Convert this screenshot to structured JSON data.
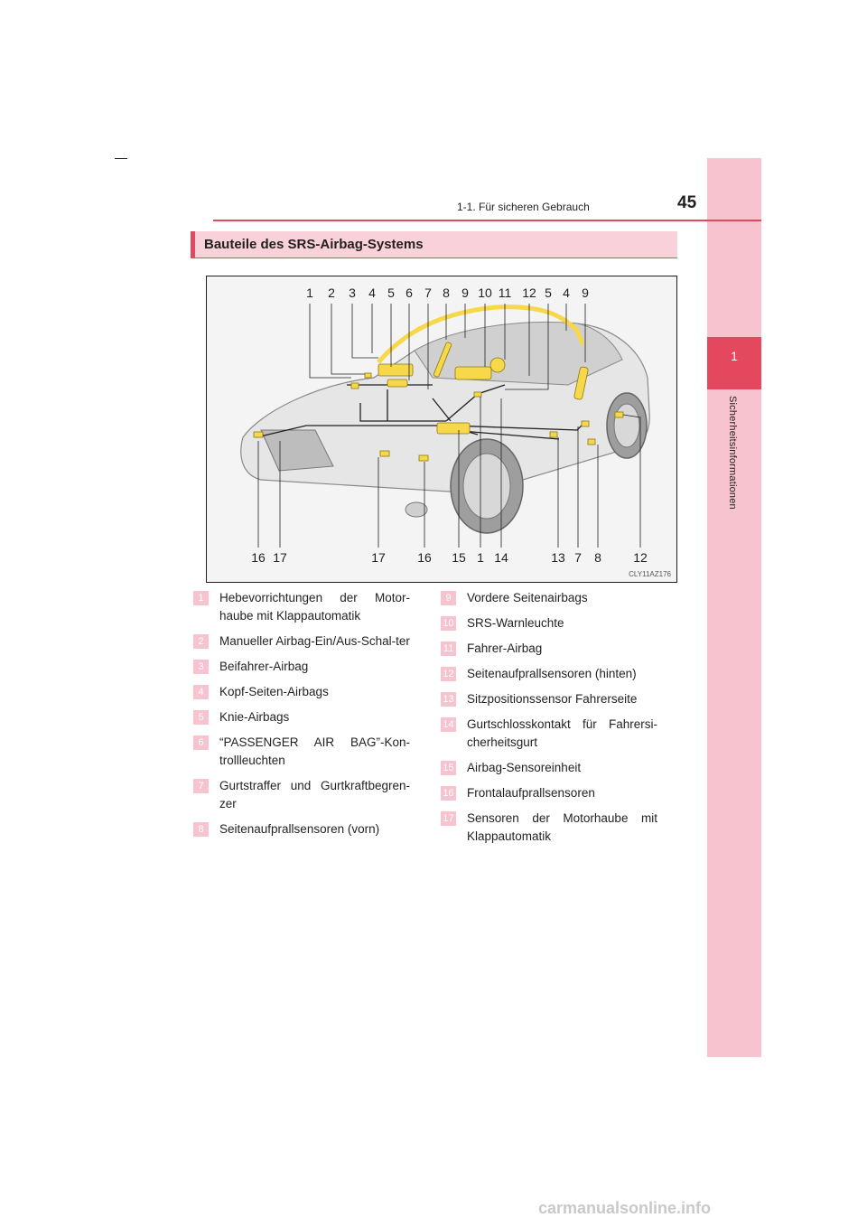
{
  "header": {
    "section": "1-1. Für sicheren Gebrauch",
    "page_number": "45"
  },
  "side_tab": {
    "chapter_number": "1",
    "chapter_title": "Sicherheitsinformationen"
  },
  "heading": "Bauteile des SRS-Airbag-Systems",
  "figure": {
    "top_callouts": [
      "1",
      "2",
      "3",
      "4",
      "5",
      "6",
      "7",
      "8",
      "9",
      "10",
      "11",
      "12",
      "5",
      "4",
      "9"
    ],
    "bottom_callouts": [
      "16",
      "17",
      "17",
      "16",
      "15",
      "1",
      "14",
      "13",
      "7",
      "8",
      "12"
    ],
    "code": "CLY11AZ176"
  },
  "items_left": [
    {
      "num": "1",
      "text": "Hebevorrichtungen der Motor-haube mit Klappautomatik"
    },
    {
      "num": "2",
      "text": "Manueller Airbag-Ein/Aus-Schal-ter"
    },
    {
      "num": "3",
      "text": "Beifahrer-Airbag"
    },
    {
      "num": "4",
      "text": "Kopf-Seiten-Airbags"
    },
    {
      "num": "5",
      "text": "Knie-Airbags"
    },
    {
      "num": "6",
      "text": "“PASSENGER AIR BAG”-Kon-trollleuchten"
    },
    {
      "num": "7",
      "text": "Gurtstraffer und Gurtkraftbegren-zer"
    },
    {
      "num": "8",
      "text": "Seitenaufprallsensoren (vorn)"
    }
  ],
  "items_right": [
    {
      "num": "9",
      "text": "Vordere Seitenairbags"
    },
    {
      "num": "10",
      "text": "SRS-Warnleuchte"
    },
    {
      "num": "11",
      "text": "Fahrer-Airbag"
    },
    {
      "num": "12",
      "text": "Seitenaufprallsensoren (hinten)"
    },
    {
      "num": "13",
      "text": "Sitzpositionssensor Fahrerseite"
    },
    {
      "num": "14",
      "text": "Gurtschlosskontakt für Fahrersi-cherheitsgurt"
    },
    {
      "num": "15",
      "text": "Airbag-Sensoreinheit"
    },
    {
      "num": "16",
      "text": "Frontalaufprallsensoren"
    },
    {
      "num": "17",
      "text": "Sensoren der Motorhaube mit Klappautomatik"
    }
  ],
  "watermark": "carmanualsonline.info"
}
